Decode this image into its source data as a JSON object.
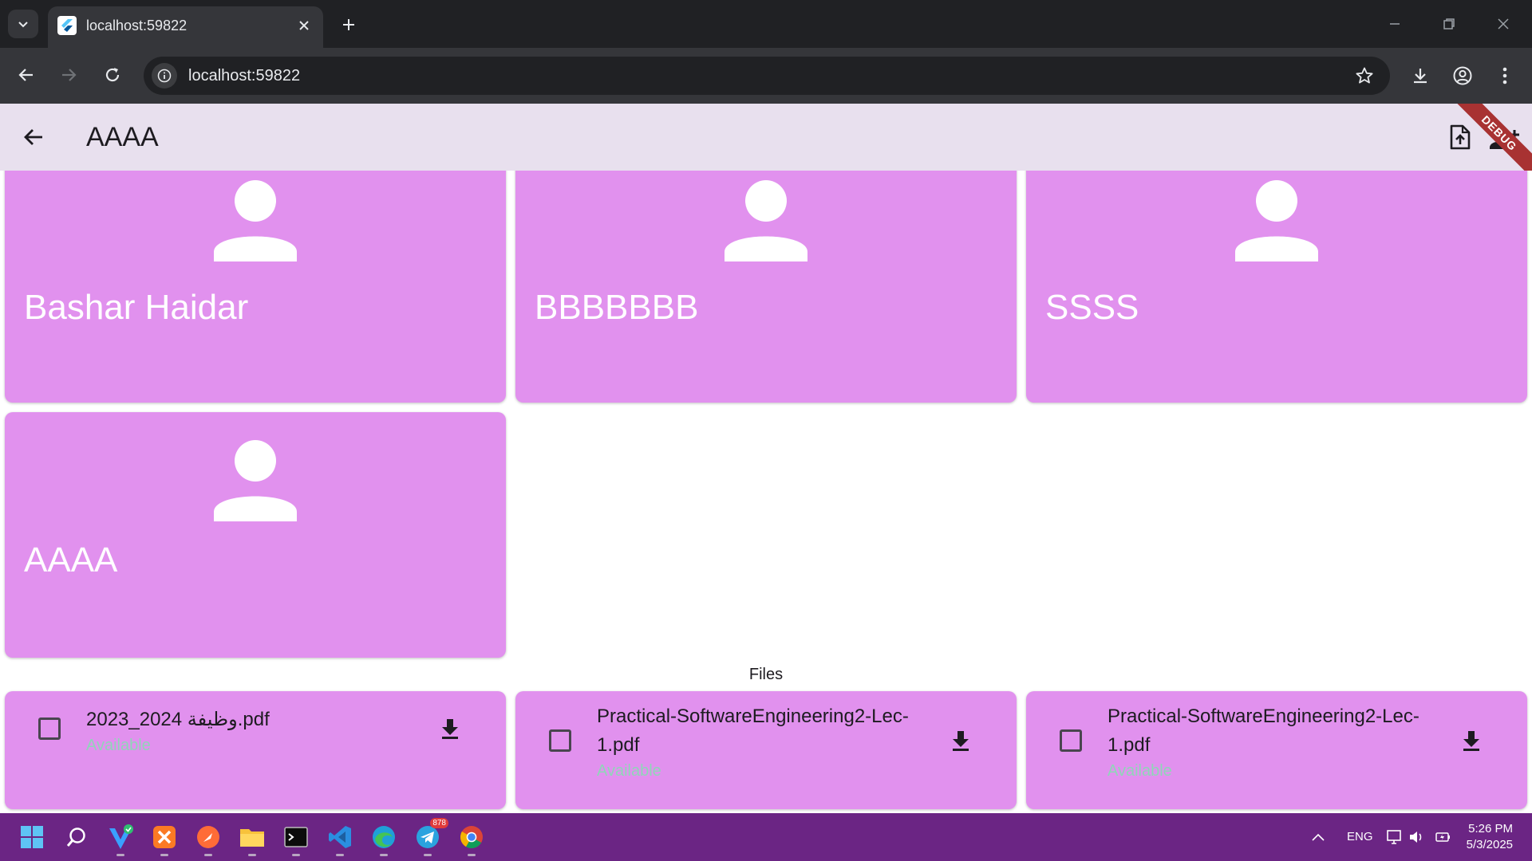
{
  "browser": {
    "tab_title": "localhost:59822",
    "url": "localhost:59822"
  },
  "app": {
    "title": "AAAA",
    "debug_banner": "DEBUG",
    "members": [
      {
        "name": "Bashar Haidar"
      },
      {
        "name": "BBBBBBB"
      },
      {
        "name": "SSSS"
      },
      {
        "name": "AAAA"
      }
    ],
    "files_heading": "Files",
    "files": [
      {
        "name": "2023_2024 وظيفة.pdf",
        "status": "Available",
        "checked": false
      },
      {
        "name": "Practical-SoftwareEngineering2-Lec-1.pdf",
        "status": "Available",
        "checked": false
      },
      {
        "name": "Practical-SoftwareEngineering2-Lec-1.pdf",
        "status": "Available",
        "checked": false
      }
    ]
  },
  "taskbar": {
    "apps": [
      "windows-start",
      "search",
      "vpn",
      "xampp",
      "postman",
      "file-explorer",
      "terminal",
      "vscode",
      "edge",
      "telegram",
      "chrome"
    ],
    "telegram_badge": "878",
    "language": "ENG",
    "time": "5:26 PM",
    "date": "5/3/2025"
  },
  "colors": {
    "card": "#e191ee",
    "app_bar": "#e8e0ee",
    "status_available": "#8fd6b8",
    "taskbar": "#6b2584"
  }
}
